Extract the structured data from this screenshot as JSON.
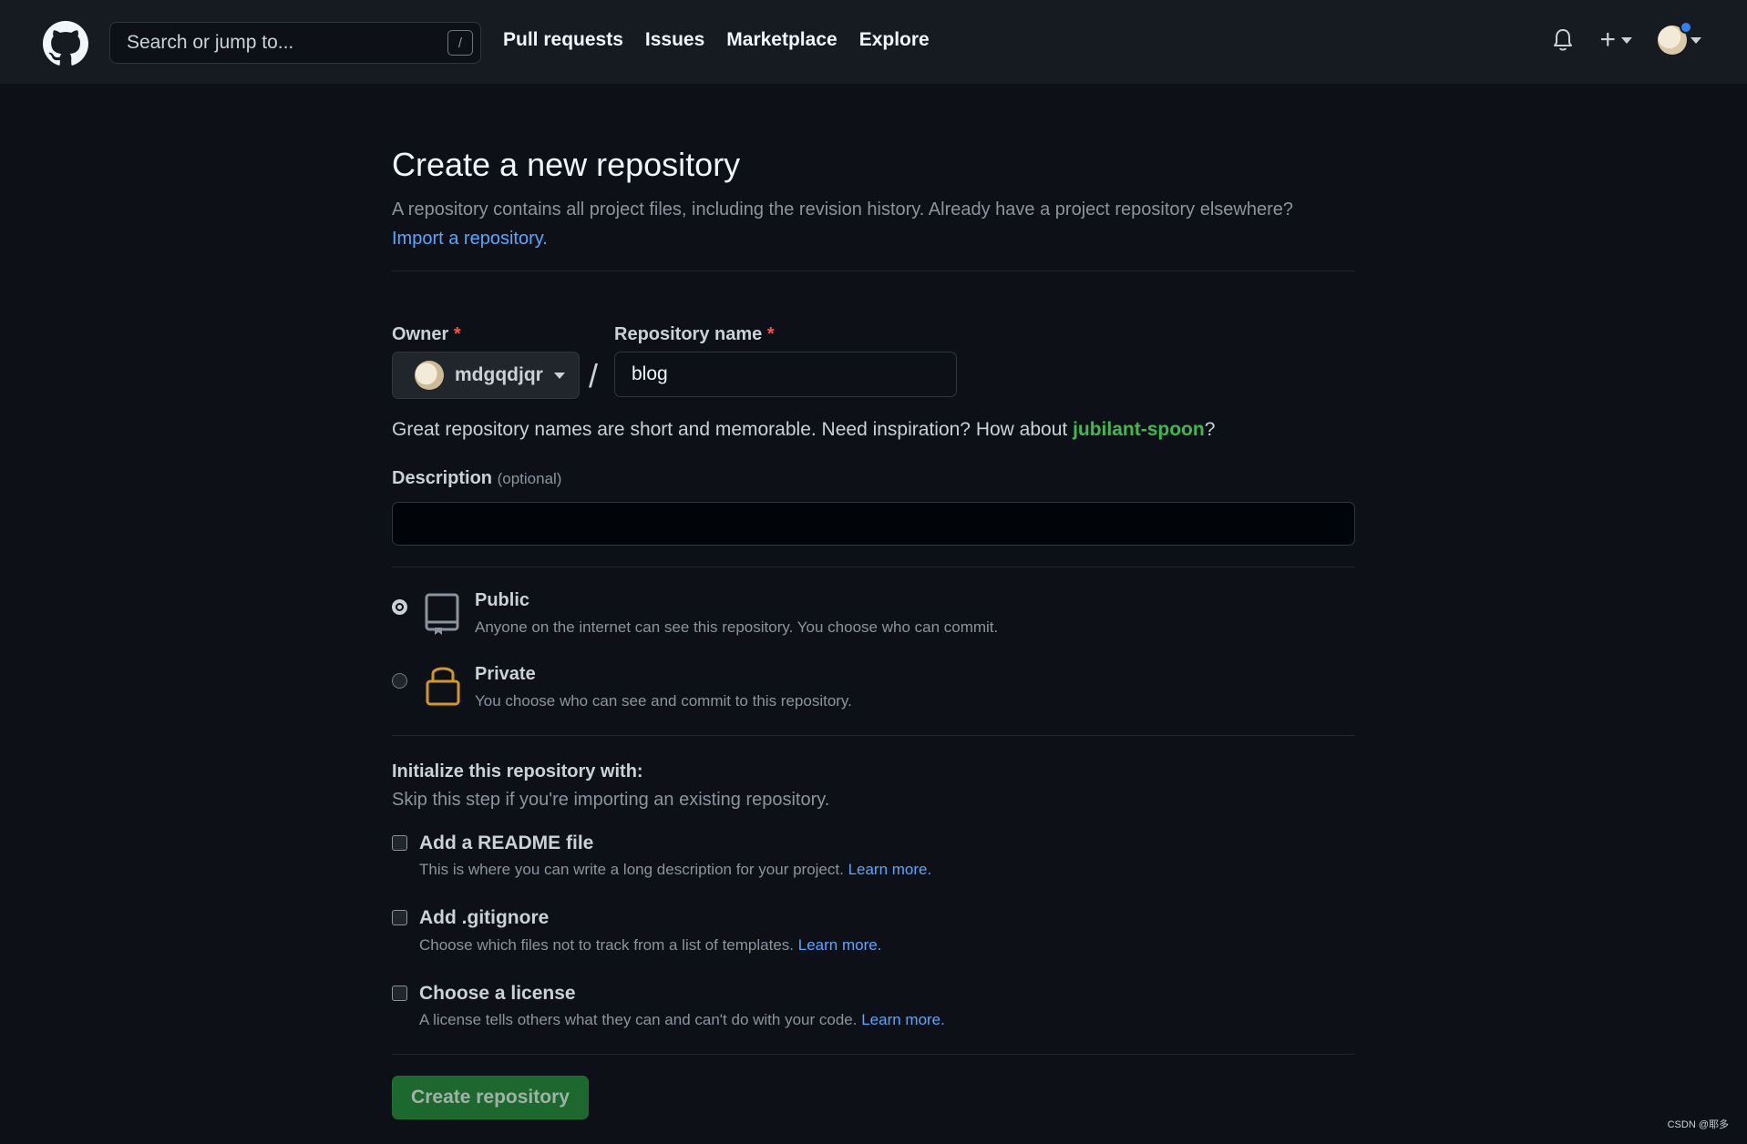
{
  "header": {
    "search_placeholder": "Search or jump to...",
    "search_shortcut": "/",
    "nav": [
      "Pull requests",
      "Issues",
      "Marketplace",
      "Explore"
    ],
    "plus_label": "+"
  },
  "page": {
    "title": "Create a new repository",
    "subtitle": "A repository contains all project files, including the revision history. Already have a project repository elsewhere?",
    "import_link": "Import a repository."
  },
  "form": {
    "owner_label": "Owner",
    "repo_label": "Repository name",
    "required_mark": "*",
    "owner_value": "mdgqdjqr",
    "separator": "/",
    "repo_value": "blog",
    "hint_prefix": "Great repository names are short and memorable. Need inspiration? How about ",
    "hint_suggestion": "jubilant-spoon",
    "hint_suffix": "?",
    "description_label": "Description",
    "description_optional": "(optional)",
    "description_value": ""
  },
  "visibility": {
    "selected": "public",
    "options": [
      {
        "title": "Public",
        "desc": "Anyone on the internet can see this repository. You choose who can commit."
      },
      {
        "title": "Private",
        "desc": "You choose who can see and commit to this repository."
      }
    ]
  },
  "init": {
    "title": "Initialize this repository with:",
    "subtitle": "Skip this step if you're importing an existing repository.",
    "items": [
      {
        "title": "Add a README file",
        "desc": "This is where you can write a long description for your project.",
        "link": "Learn more.",
        "checked": false
      },
      {
        "title": "Add .gitignore",
        "desc": "Choose which files not to track from a list of templates.",
        "link": "Learn more.",
        "checked": false
      },
      {
        "title": "Choose a license",
        "desc": "A license tells others what they can and can't do with your code.",
        "link": "Learn more.",
        "checked": false
      }
    ]
  },
  "submit_label": "Create repository",
  "watermark": "CSDN @耶多",
  "colors": {
    "background": "#0d1117",
    "header": "#161b22",
    "link": "#58a6ff",
    "suggestion": "#3fb950",
    "button": "#238636",
    "lock_icon": "#d29922"
  }
}
